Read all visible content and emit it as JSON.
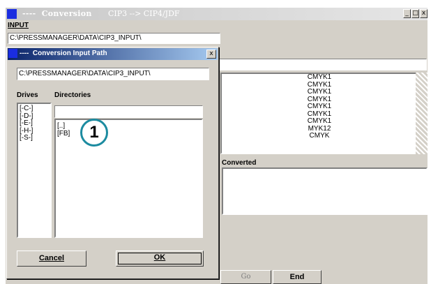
{
  "window": {
    "title": "----  Conversion",
    "subtitle": "CIP3 --> CIP4/JDF",
    "min_label": "_",
    "max_label": "□",
    "close_label": "x"
  },
  "main": {
    "input_label": "INPUT",
    "input_path": "C:\\PRESSMANAGER\\DATA\\CIP3_INPUT\\",
    "file_list": [
      "CMYK1",
      "CMYK1",
      "CMYK1",
      "CMYK1",
      "CMYK1",
      "CMYK1",
      "CMYK1",
      "MYK12",
      "CMYK"
    ],
    "converted_label": "Converted",
    "go_label": "Go",
    "end_label": "End"
  },
  "dialog": {
    "title": "----  Conversion Input Path",
    "close_label": "x",
    "path": "C:\\PRESSMANAGER\\DATA\\CIP3_INPUT\\",
    "drives_label": "Drives",
    "directories_label": "Directories",
    "drives": [
      "[-C-]",
      "[-D-]",
      "[-E-]",
      "[-H-]",
      "[-S-]"
    ],
    "directories": [
      "[..]",
      "[FB]"
    ],
    "cancel_label": "Cancel",
    "ok_label": "OK",
    "callout": "1"
  },
  "colors": {
    "dialog_title": "#0a246a",
    "accent": "#1a2de0",
    "callout_border": "#1c8ba0"
  }
}
